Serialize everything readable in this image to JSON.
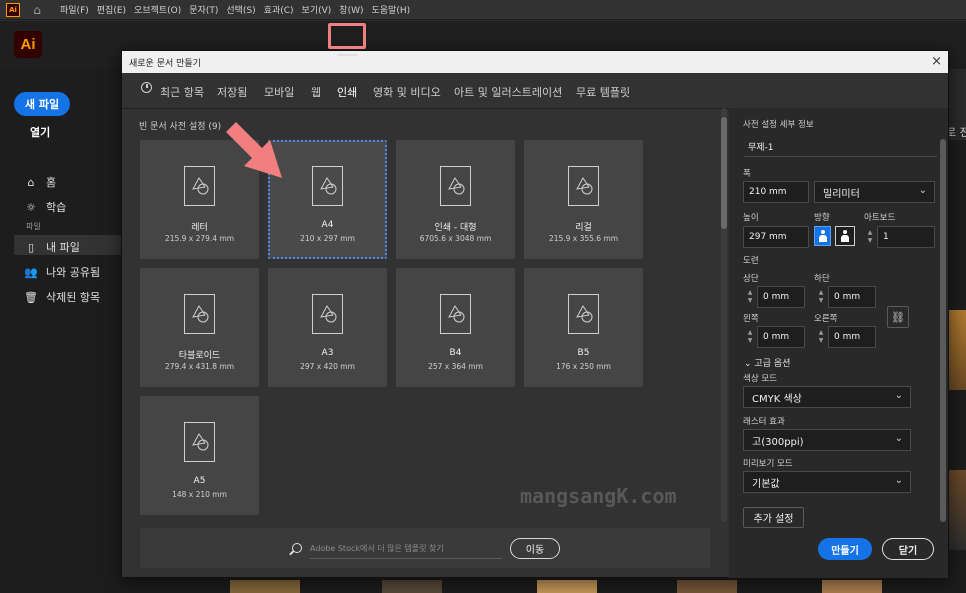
{
  "menubar": {
    "items": [
      "파일(F)",
      "편집(E)",
      "오브젝트(O)",
      "문자(T)",
      "선택(S)",
      "효과(C)",
      "보기(V)",
      "창(W)",
      "도움말(H)"
    ]
  },
  "app": {
    "logo_text": "Ai",
    "mini_logo_text": "Ai"
  },
  "sidebar": {
    "new_file": "새 파일",
    "open": "열기",
    "home": "홈",
    "learn": "학습",
    "files_label": "파일",
    "my_files": "내 파일",
    "shared": "나와 공유됨",
    "deleted": "삭제된 항목"
  },
  "background": {
    "right_text": "로 전"
  },
  "dialog": {
    "title": "새로운 문서 만들기",
    "close_glyph": "×",
    "tabs": [
      "최근 항목",
      "저장됨",
      "모바일",
      "웹",
      "인쇄",
      "영화 및 비디오",
      "아트 및 일러스트레이션",
      "무료 템플릿"
    ],
    "active_tab": "인쇄",
    "presets_label": "빈 문서 사전 설정",
    "presets_count": "(9)",
    "presets": [
      {
        "name": "레터",
        "size": "215.9 x 279.4 mm"
      },
      {
        "name": "A4",
        "size": "210 x 297 mm"
      },
      {
        "name": "인쇄 - 대형",
        "size": "6705.6 x 3048 mm"
      },
      {
        "name": "리걸",
        "size": "215.9 x 355.6 mm"
      },
      {
        "name": "타블로이드",
        "size": "279.4 x 431.8 mm"
      },
      {
        "name": "A3",
        "size": "297 x 420 mm"
      },
      {
        "name": "B4",
        "size": "257 x 364 mm"
      },
      {
        "name": "B5",
        "size": "176 x 250 mm"
      },
      {
        "name": "A5",
        "size": "148 x 210 mm"
      }
    ],
    "selected_preset": "A4",
    "search": {
      "placeholder": "Adobe Stock에서 더 많은 템플릿 찾기",
      "go_label": "이동"
    }
  },
  "details": {
    "header": "사전 설정 세부 정보",
    "doc_name": "무제-1",
    "width_label": "폭",
    "width_value": "210 mm",
    "unit": "밀리미터",
    "height_label": "높이",
    "height_value": "297 mm",
    "orientation_label": "방향",
    "artboards_label": "아트보드",
    "artboards_value": "1",
    "bleed_label": "도련",
    "top_label": "상단",
    "top_value": "0 mm",
    "bottom_label": "하단",
    "bottom_value": "0 mm",
    "left_label": "왼쪽",
    "left_value": "0 mm",
    "right_label": "오른쪽",
    "right_value": "0 mm",
    "advanced_toggle": "고급 옵션",
    "color_mode_label": "색상 모드",
    "color_mode_value": "CMYK 색상",
    "raster_label": "래스터 효과",
    "raster_value": "고(300ppi)",
    "preview_label": "미리보기 모드",
    "preview_value": "기본값",
    "more_settings": "추가 설정",
    "create": "만들기",
    "close": "닫기"
  },
  "watermark": "mangsangK.com",
  "colors": {
    "accent": "#1473e6",
    "highlight": "#f08080",
    "dialog_bg": "#323232"
  }
}
